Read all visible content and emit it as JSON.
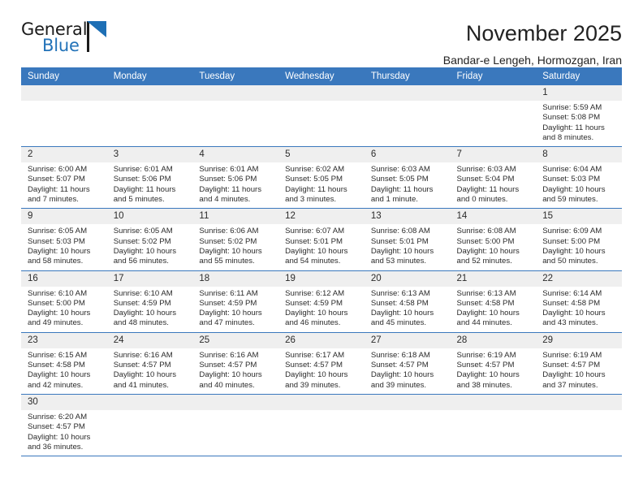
{
  "brand": {
    "name_top": "General",
    "name_bottom": "Blue",
    "accent_color": "#2272b8",
    "triangle_icon": "triangle-icon"
  },
  "header": {
    "title": "November 2025",
    "subtitle": "Bandar-e Lengeh, Hormozgan, Iran"
  },
  "calendar": {
    "header_bg": "#3a78bd",
    "daynum_bg": "#efefef",
    "weekday_headers": [
      "Sunday",
      "Monday",
      "Tuesday",
      "Wednesday",
      "Thursday",
      "Friday",
      "Saturday"
    ],
    "weeks": [
      [
        {
          "day": "",
          "sunrise": "",
          "sunset": "",
          "daylight": "",
          "empty": true
        },
        {
          "day": "",
          "sunrise": "",
          "sunset": "",
          "daylight": "",
          "empty": true
        },
        {
          "day": "",
          "sunrise": "",
          "sunset": "",
          "daylight": "",
          "empty": true
        },
        {
          "day": "",
          "sunrise": "",
          "sunset": "",
          "daylight": "",
          "empty": true
        },
        {
          "day": "",
          "sunrise": "",
          "sunset": "",
          "daylight": "",
          "empty": true
        },
        {
          "day": "",
          "sunrise": "",
          "sunset": "",
          "daylight": "",
          "empty": true
        },
        {
          "day": "1",
          "sunrise": "Sunrise: 5:59 AM",
          "sunset": "Sunset: 5:08 PM",
          "daylight": "Daylight: 11 hours and 8 minutes."
        }
      ],
      [
        {
          "day": "2",
          "sunrise": "Sunrise: 6:00 AM",
          "sunset": "Sunset: 5:07 PM",
          "daylight": "Daylight: 11 hours and 7 minutes."
        },
        {
          "day": "3",
          "sunrise": "Sunrise: 6:01 AM",
          "sunset": "Sunset: 5:06 PM",
          "daylight": "Daylight: 11 hours and 5 minutes."
        },
        {
          "day": "4",
          "sunrise": "Sunrise: 6:01 AM",
          "sunset": "Sunset: 5:06 PM",
          "daylight": "Daylight: 11 hours and 4 minutes."
        },
        {
          "day": "5",
          "sunrise": "Sunrise: 6:02 AM",
          "sunset": "Sunset: 5:05 PM",
          "daylight": "Daylight: 11 hours and 3 minutes."
        },
        {
          "day": "6",
          "sunrise": "Sunrise: 6:03 AM",
          "sunset": "Sunset: 5:05 PM",
          "daylight": "Daylight: 11 hours and 1 minute."
        },
        {
          "day": "7",
          "sunrise": "Sunrise: 6:03 AM",
          "sunset": "Sunset: 5:04 PM",
          "daylight": "Daylight: 11 hours and 0 minutes."
        },
        {
          "day": "8",
          "sunrise": "Sunrise: 6:04 AM",
          "sunset": "Sunset: 5:03 PM",
          "daylight": "Daylight: 10 hours and 59 minutes."
        }
      ],
      [
        {
          "day": "9",
          "sunrise": "Sunrise: 6:05 AM",
          "sunset": "Sunset: 5:03 PM",
          "daylight": "Daylight: 10 hours and 58 minutes."
        },
        {
          "day": "10",
          "sunrise": "Sunrise: 6:05 AM",
          "sunset": "Sunset: 5:02 PM",
          "daylight": "Daylight: 10 hours and 56 minutes."
        },
        {
          "day": "11",
          "sunrise": "Sunrise: 6:06 AM",
          "sunset": "Sunset: 5:02 PM",
          "daylight": "Daylight: 10 hours and 55 minutes."
        },
        {
          "day": "12",
          "sunrise": "Sunrise: 6:07 AM",
          "sunset": "Sunset: 5:01 PM",
          "daylight": "Daylight: 10 hours and 54 minutes."
        },
        {
          "day": "13",
          "sunrise": "Sunrise: 6:08 AM",
          "sunset": "Sunset: 5:01 PM",
          "daylight": "Daylight: 10 hours and 53 minutes."
        },
        {
          "day": "14",
          "sunrise": "Sunrise: 6:08 AM",
          "sunset": "Sunset: 5:00 PM",
          "daylight": "Daylight: 10 hours and 52 minutes."
        },
        {
          "day": "15",
          "sunrise": "Sunrise: 6:09 AM",
          "sunset": "Sunset: 5:00 PM",
          "daylight": "Daylight: 10 hours and 50 minutes."
        }
      ],
      [
        {
          "day": "16",
          "sunrise": "Sunrise: 6:10 AM",
          "sunset": "Sunset: 5:00 PM",
          "daylight": "Daylight: 10 hours and 49 minutes."
        },
        {
          "day": "17",
          "sunrise": "Sunrise: 6:10 AM",
          "sunset": "Sunset: 4:59 PM",
          "daylight": "Daylight: 10 hours and 48 minutes."
        },
        {
          "day": "18",
          "sunrise": "Sunrise: 6:11 AM",
          "sunset": "Sunset: 4:59 PM",
          "daylight": "Daylight: 10 hours and 47 minutes."
        },
        {
          "day": "19",
          "sunrise": "Sunrise: 6:12 AM",
          "sunset": "Sunset: 4:59 PM",
          "daylight": "Daylight: 10 hours and 46 minutes."
        },
        {
          "day": "20",
          "sunrise": "Sunrise: 6:13 AM",
          "sunset": "Sunset: 4:58 PM",
          "daylight": "Daylight: 10 hours and 45 minutes."
        },
        {
          "day": "21",
          "sunrise": "Sunrise: 6:13 AM",
          "sunset": "Sunset: 4:58 PM",
          "daylight": "Daylight: 10 hours and 44 minutes."
        },
        {
          "day": "22",
          "sunrise": "Sunrise: 6:14 AM",
          "sunset": "Sunset: 4:58 PM",
          "daylight": "Daylight: 10 hours and 43 minutes."
        }
      ],
      [
        {
          "day": "23",
          "sunrise": "Sunrise: 6:15 AM",
          "sunset": "Sunset: 4:58 PM",
          "daylight": "Daylight: 10 hours and 42 minutes."
        },
        {
          "day": "24",
          "sunrise": "Sunrise: 6:16 AM",
          "sunset": "Sunset: 4:57 PM",
          "daylight": "Daylight: 10 hours and 41 minutes."
        },
        {
          "day": "25",
          "sunrise": "Sunrise: 6:16 AM",
          "sunset": "Sunset: 4:57 PM",
          "daylight": "Daylight: 10 hours and 40 minutes."
        },
        {
          "day": "26",
          "sunrise": "Sunrise: 6:17 AM",
          "sunset": "Sunset: 4:57 PM",
          "daylight": "Daylight: 10 hours and 39 minutes."
        },
        {
          "day": "27",
          "sunrise": "Sunrise: 6:18 AM",
          "sunset": "Sunset: 4:57 PM",
          "daylight": "Daylight: 10 hours and 39 minutes."
        },
        {
          "day": "28",
          "sunrise": "Sunrise: 6:19 AM",
          "sunset": "Sunset: 4:57 PM",
          "daylight": "Daylight: 10 hours and 38 minutes."
        },
        {
          "day": "29",
          "sunrise": "Sunrise: 6:19 AM",
          "sunset": "Sunset: 4:57 PM",
          "daylight": "Daylight: 10 hours and 37 minutes."
        }
      ],
      [
        {
          "day": "30",
          "sunrise": "Sunrise: 6:20 AM",
          "sunset": "Sunset: 4:57 PM",
          "daylight": "Daylight: 10 hours and 36 minutes."
        },
        {
          "day": "",
          "sunrise": "",
          "sunset": "",
          "daylight": "",
          "empty": true
        },
        {
          "day": "",
          "sunrise": "",
          "sunset": "",
          "daylight": "",
          "empty": true
        },
        {
          "day": "",
          "sunrise": "",
          "sunset": "",
          "daylight": "",
          "empty": true
        },
        {
          "day": "",
          "sunrise": "",
          "sunset": "",
          "daylight": "",
          "empty": true
        },
        {
          "day": "",
          "sunrise": "",
          "sunset": "",
          "daylight": "",
          "empty": true
        },
        {
          "day": "",
          "sunrise": "",
          "sunset": "",
          "daylight": "",
          "empty": true
        }
      ]
    ]
  }
}
